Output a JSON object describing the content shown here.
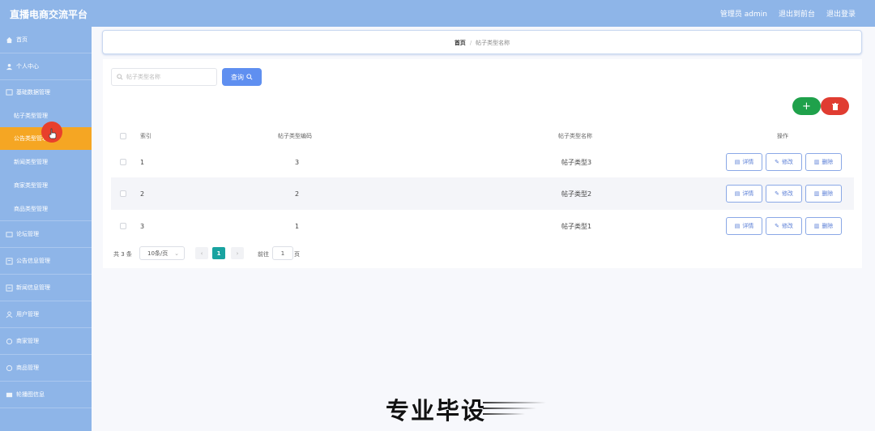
{
  "app": {
    "title": "直播电商交流平台"
  },
  "topbar": {
    "links": [
      "管理员 admin",
      "退出到前台",
      "退出登录"
    ]
  },
  "sidebar": {
    "items": [
      {
        "label": "首页",
        "icon": "home-icon",
        "level": 1
      },
      {
        "label": "个人中心",
        "icon": "user-icon",
        "level": 1
      },
      {
        "label": "基础数据管理",
        "icon": "folder-icon",
        "level": 1
      },
      {
        "label": "帖子类型管理",
        "level": 2
      },
      {
        "label": "公告类型管理",
        "level": 2,
        "active": true
      },
      {
        "label": "新闻类型管理",
        "level": 2
      },
      {
        "label": "商家类型管理",
        "level": 2
      },
      {
        "label": "商品类型管理",
        "level": 2
      },
      {
        "label": "论坛管理",
        "icon": "forum-icon",
        "level": 1
      },
      {
        "label": "公告信息管理",
        "icon": "notice-icon",
        "level": 1
      },
      {
        "label": "新闻信息管理",
        "icon": "news-icon",
        "level": 1
      },
      {
        "label": "用户管理",
        "icon": "users-icon",
        "level": 1
      },
      {
        "label": "商家管理",
        "icon": "shop-icon",
        "level": 1
      },
      {
        "label": "商品管理",
        "icon": "goods-icon",
        "level": 1
      },
      {
        "label": "轮播图信息",
        "icon": "image-icon",
        "level": 1
      }
    ]
  },
  "breadcrumb": {
    "home": "首页",
    "current": "帖子类型名称"
  },
  "search": {
    "placeholder": "帖子类型名称",
    "button": "查询"
  },
  "toolbar": {
    "add_label": "+",
    "delete_icon": "trash-icon"
  },
  "table": {
    "headers": {
      "index": "索引",
      "code": "帖子类型编码",
      "name": "帖子类型名称",
      "ops": "操作"
    },
    "rows": [
      {
        "index": "1",
        "code": "3",
        "name": "帖子类型3"
      },
      {
        "index": "2",
        "code": "2",
        "name": "帖子类型2"
      },
      {
        "index": "3",
        "code": "1",
        "name": "帖子类型1"
      }
    ],
    "actions": {
      "detail": "详情",
      "edit": "修改",
      "delete": "删除"
    }
  },
  "pagination": {
    "total": "共 3 条",
    "page_size": "10条/页",
    "current_page": "1",
    "goto_label": "前往",
    "goto_value": "1",
    "page_unit": "页"
  },
  "watermark": "专业毕设",
  "colors": {
    "sidebar": "#8eb5e8",
    "active": "#f5a623",
    "primary": "#5f8ff0",
    "success": "#1fa14b",
    "danger": "#e03c31",
    "page_active": "#19a3a0"
  }
}
